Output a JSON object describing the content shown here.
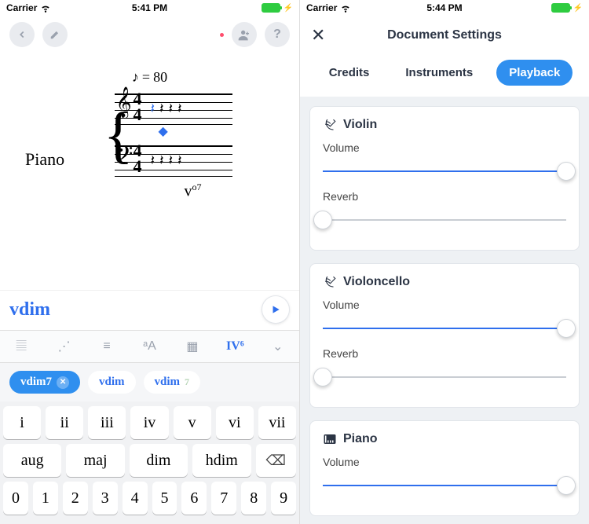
{
  "left": {
    "status": {
      "carrier": "Carrier",
      "time": "5:41 PM"
    },
    "tempo": {
      "note": "♪",
      "equals": "=",
      "bpm": "80"
    },
    "instrument_label": "Piano",
    "treble_timesig_top": "4",
    "treble_timesig_bot": "4",
    "bass_timesig_top": "4",
    "bass_timesig_bot": "4",
    "analysis_prefix": "v",
    "analysis_super": "o7",
    "chord_input": "vdim",
    "icon_row_active": "IV⁶",
    "chips": [
      {
        "label": "vdim7",
        "selected": true,
        "closable": true
      },
      {
        "label": "vdim",
        "selected": false
      },
      {
        "label": "vdim",
        "suffix": "7",
        "selected": false
      }
    ],
    "kb_row1": [
      "i",
      "ii",
      "iii",
      "iv",
      "v",
      "vi",
      "vii"
    ],
    "kb_row2": [
      "aug",
      "maj",
      "dim",
      "hdim"
    ],
    "kb_row3": [
      "0",
      "1",
      "2",
      "3",
      "4",
      "5",
      "6",
      "7",
      "8",
      "9"
    ]
  },
  "right": {
    "status": {
      "carrier": "Carrier",
      "time": "5:44 PM"
    },
    "title": "Document Settings",
    "tabs": [
      "Credits",
      "Instruments",
      "Playback"
    ],
    "active_tab": 2,
    "cards": [
      {
        "icon": "violin",
        "name": "Violin",
        "controls": [
          {
            "label": "Volume",
            "value": 100
          },
          {
            "label": "Reverb",
            "value": 0
          }
        ]
      },
      {
        "icon": "violin",
        "name": "Violoncello",
        "controls": [
          {
            "label": "Volume",
            "value": 100
          },
          {
            "label": "Reverb",
            "value": 0
          }
        ]
      },
      {
        "icon": "piano",
        "name": "Piano",
        "controls": [
          {
            "label": "Volume",
            "value": 100
          }
        ]
      }
    ]
  }
}
